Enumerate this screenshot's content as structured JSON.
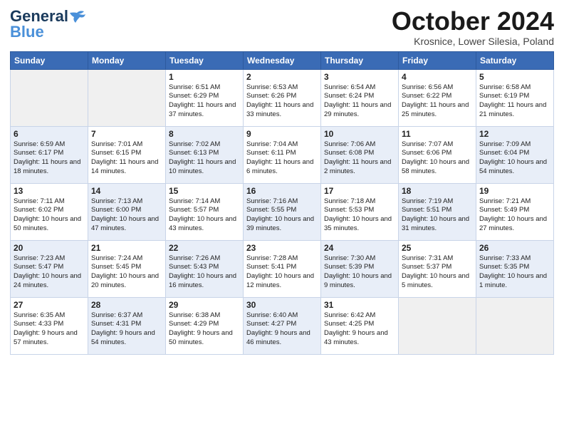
{
  "header": {
    "logo_general": "General",
    "logo_blue": "Blue",
    "title": "October 2024",
    "location": "Krosnice, Lower Silesia, Poland"
  },
  "days_header": [
    "Sunday",
    "Monday",
    "Tuesday",
    "Wednesday",
    "Thursday",
    "Friday",
    "Saturday"
  ],
  "weeks": [
    [
      {
        "day": "",
        "empty": true
      },
      {
        "day": "",
        "empty": true
      },
      {
        "day": "1",
        "sunrise": "Sunrise: 6:51 AM",
        "sunset": "Sunset: 6:29 PM",
        "daylight": "Daylight: 11 hours and 37 minutes."
      },
      {
        "day": "2",
        "sunrise": "Sunrise: 6:53 AM",
        "sunset": "Sunset: 6:26 PM",
        "daylight": "Daylight: 11 hours and 33 minutes."
      },
      {
        "day": "3",
        "sunrise": "Sunrise: 6:54 AM",
        "sunset": "Sunset: 6:24 PM",
        "daylight": "Daylight: 11 hours and 29 minutes."
      },
      {
        "day": "4",
        "sunrise": "Sunrise: 6:56 AM",
        "sunset": "Sunset: 6:22 PM",
        "daylight": "Daylight: 11 hours and 25 minutes."
      },
      {
        "day": "5",
        "sunrise": "Sunrise: 6:58 AM",
        "sunset": "Sunset: 6:19 PM",
        "daylight": "Daylight: 11 hours and 21 minutes."
      }
    ],
    [
      {
        "day": "6",
        "sunrise": "Sunrise: 6:59 AM",
        "sunset": "Sunset: 6:17 PM",
        "daylight": "Daylight: 11 hours and 18 minutes.",
        "shaded": true
      },
      {
        "day": "7",
        "sunrise": "Sunrise: 7:01 AM",
        "sunset": "Sunset: 6:15 PM",
        "daylight": "Daylight: 11 hours and 14 minutes."
      },
      {
        "day": "8",
        "sunrise": "Sunrise: 7:02 AM",
        "sunset": "Sunset: 6:13 PM",
        "daylight": "Daylight: 11 hours and 10 minutes.",
        "shaded": true
      },
      {
        "day": "9",
        "sunrise": "Sunrise: 7:04 AM",
        "sunset": "Sunset: 6:11 PM",
        "daylight": "Daylight: 11 hours and 6 minutes."
      },
      {
        "day": "10",
        "sunrise": "Sunrise: 7:06 AM",
        "sunset": "Sunset: 6:08 PM",
        "daylight": "Daylight: 11 hours and 2 minutes.",
        "shaded": true
      },
      {
        "day": "11",
        "sunrise": "Sunrise: 7:07 AM",
        "sunset": "Sunset: 6:06 PM",
        "daylight": "Daylight: 10 hours and 58 minutes."
      },
      {
        "day": "12",
        "sunrise": "Sunrise: 7:09 AM",
        "sunset": "Sunset: 6:04 PM",
        "daylight": "Daylight: 10 hours and 54 minutes.",
        "shaded": true
      }
    ],
    [
      {
        "day": "13",
        "sunrise": "Sunrise: 7:11 AM",
        "sunset": "Sunset: 6:02 PM",
        "daylight": "Daylight: 10 hours and 50 minutes."
      },
      {
        "day": "14",
        "sunrise": "Sunrise: 7:13 AM",
        "sunset": "Sunset: 6:00 PM",
        "daylight": "Daylight: 10 hours and 47 minutes.",
        "shaded": true
      },
      {
        "day": "15",
        "sunrise": "Sunrise: 7:14 AM",
        "sunset": "Sunset: 5:57 PM",
        "daylight": "Daylight: 10 hours and 43 minutes."
      },
      {
        "day": "16",
        "sunrise": "Sunrise: 7:16 AM",
        "sunset": "Sunset: 5:55 PM",
        "daylight": "Daylight: 10 hours and 39 minutes.",
        "shaded": true
      },
      {
        "day": "17",
        "sunrise": "Sunrise: 7:18 AM",
        "sunset": "Sunset: 5:53 PM",
        "daylight": "Daylight: 10 hours and 35 minutes."
      },
      {
        "day": "18",
        "sunrise": "Sunrise: 7:19 AM",
        "sunset": "Sunset: 5:51 PM",
        "daylight": "Daylight: 10 hours and 31 minutes.",
        "shaded": true
      },
      {
        "day": "19",
        "sunrise": "Sunrise: 7:21 AM",
        "sunset": "Sunset: 5:49 PM",
        "daylight": "Daylight: 10 hours and 27 minutes."
      }
    ],
    [
      {
        "day": "20",
        "sunrise": "Sunrise: 7:23 AM",
        "sunset": "Sunset: 5:47 PM",
        "daylight": "Daylight: 10 hours and 24 minutes.",
        "shaded": true
      },
      {
        "day": "21",
        "sunrise": "Sunrise: 7:24 AM",
        "sunset": "Sunset: 5:45 PM",
        "daylight": "Daylight: 10 hours and 20 minutes."
      },
      {
        "day": "22",
        "sunrise": "Sunrise: 7:26 AM",
        "sunset": "Sunset: 5:43 PM",
        "daylight": "Daylight: 10 hours and 16 minutes.",
        "shaded": true
      },
      {
        "day": "23",
        "sunrise": "Sunrise: 7:28 AM",
        "sunset": "Sunset: 5:41 PM",
        "daylight": "Daylight: 10 hours and 12 minutes."
      },
      {
        "day": "24",
        "sunrise": "Sunrise: 7:30 AM",
        "sunset": "Sunset: 5:39 PM",
        "daylight": "Daylight: 10 hours and 9 minutes.",
        "shaded": true
      },
      {
        "day": "25",
        "sunrise": "Sunrise: 7:31 AM",
        "sunset": "Sunset: 5:37 PM",
        "daylight": "Daylight: 10 hours and 5 minutes."
      },
      {
        "day": "26",
        "sunrise": "Sunrise: 7:33 AM",
        "sunset": "Sunset: 5:35 PM",
        "daylight": "Daylight: 10 hours and 1 minute.",
        "shaded": true
      }
    ],
    [
      {
        "day": "27",
        "sunrise": "Sunrise: 6:35 AM",
        "sunset": "Sunset: 4:33 PM",
        "daylight": "Daylight: 9 hours and 57 minutes."
      },
      {
        "day": "28",
        "sunrise": "Sunrise: 6:37 AM",
        "sunset": "Sunset: 4:31 PM",
        "daylight": "Daylight: 9 hours and 54 minutes.",
        "shaded": true
      },
      {
        "day": "29",
        "sunrise": "Sunrise: 6:38 AM",
        "sunset": "Sunset: 4:29 PM",
        "daylight": "Daylight: 9 hours and 50 minutes."
      },
      {
        "day": "30",
        "sunrise": "Sunrise: 6:40 AM",
        "sunset": "Sunset: 4:27 PM",
        "daylight": "Daylight: 9 hours and 46 minutes.",
        "shaded": true
      },
      {
        "day": "31",
        "sunrise": "Sunrise: 6:42 AM",
        "sunset": "Sunset: 4:25 PM",
        "daylight": "Daylight: 9 hours and 43 minutes."
      },
      {
        "day": "",
        "empty": true
      },
      {
        "day": "",
        "empty": true
      }
    ]
  ]
}
